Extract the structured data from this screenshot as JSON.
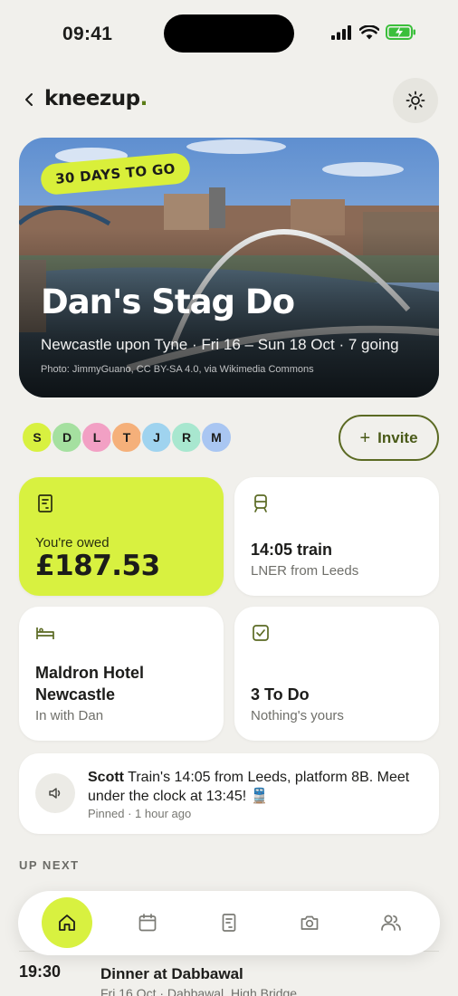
{
  "status_bar": {
    "time": "09:41"
  },
  "header": {
    "brand": "kneezup",
    "brand_dot": "."
  },
  "hero": {
    "countdown": "30 DAYS TO GO",
    "title": "Dan's Stag Do",
    "subtitle": "Newcastle upon Tyne · Fri 16 – Sun 18 Oct · 7 going",
    "credit": "Photo: JimmyGuano, CC BY-SA 4.0, via Wikimedia Commons"
  },
  "attendees": [
    {
      "initial": "S",
      "color": "#d8f140"
    },
    {
      "initial": "D",
      "color": "#a5e0a0"
    },
    {
      "initial": "L",
      "color": "#f2a0c4"
    },
    {
      "initial": "T",
      "color": "#f5b07a"
    },
    {
      "initial": "J",
      "color": "#9fd3ef"
    },
    {
      "initial": "R",
      "color": "#a8e7cf"
    },
    {
      "initial": "M",
      "color": "#a9c6f2"
    }
  ],
  "invite": {
    "label": "Invite"
  },
  "cards": {
    "owed": {
      "label": "You're owed",
      "value": "£187.53"
    },
    "train": {
      "title": "14:05 train",
      "subtitle": "LNER from Leeds"
    },
    "hotel": {
      "title_line1": "Maldron Hotel",
      "title_line2": "Newcastle",
      "subtitle": "In with Dan"
    },
    "todo": {
      "title": "3 To Do",
      "subtitle": "Nothing's yours"
    }
  },
  "pinned": {
    "author": "Scott",
    "message": " Train's 14:05 from Leeds, platform 8B. Meet under the clock at 13:45! 🚆",
    "meta": "Pinned · 1 hour ago"
  },
  "up_next": {
    "label": "UP NEXT",
    "items": [
      {
        "time": "19:30",
        "title": "Dinner at Dabbawal",
        "subtitle": "Fri 16 Oct · Dabbawal, High Bridge"
      }
    ]
  },
  "nav": [
    "home-icon",
    "calendar-icon",
    "receipt-icon",
    "camera-icon",
    "people-icon"
  ],
  "colors": {
    "accent": "#d8f140",
    "accent_dark": "#5b6a23",
    "background": "#f1f0ec"
  }
}
